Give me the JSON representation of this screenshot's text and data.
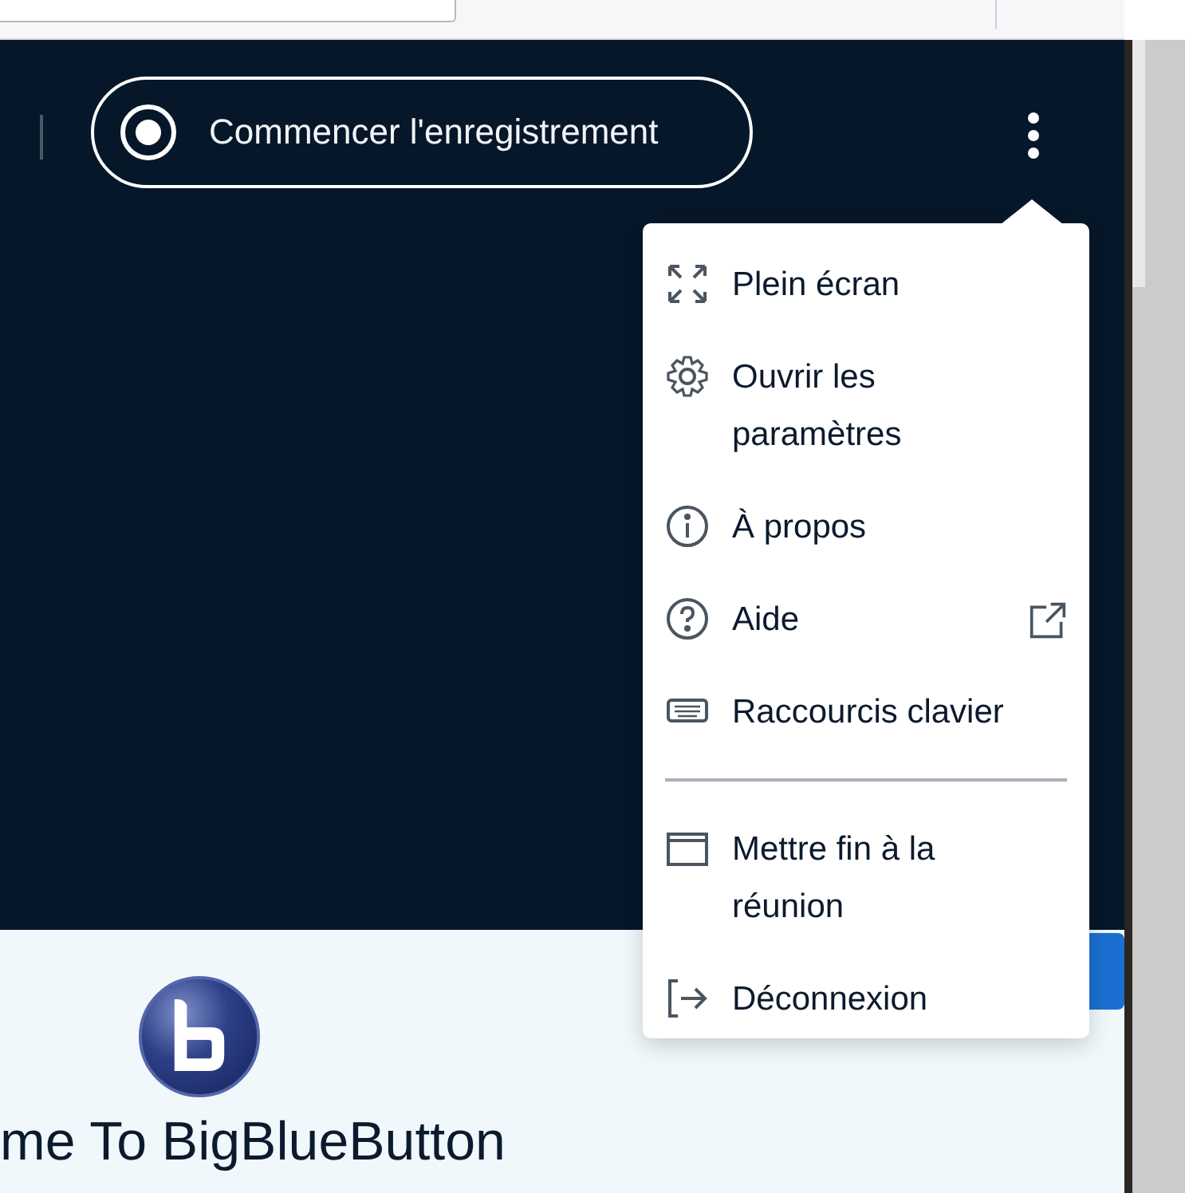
{
  "navbar": {
    "record_button": {
      "label": "Commencer l'enregistrement",
      "recording": false
    }
  },
  "options_menu": {
    "groups": [
      [
        {
          "kind": "fullscreen",
          "label": "Plein écran",
          "external": false
        },
        {
          "kind": "settings",
          "label": "Ouvrir les paramètres",
          "external": false
        },
        {
          "kind": "about",
          "label": "À propos",
          "external": false
        },
        {
          "kind": "help",
          "label": "Aide",
          "external": true
        },
        {
          "kind": "shortcuts",
          "label": "Raccourcis clavier",
          "external": false
        }
      ],
      [
        {
          "kind": "end_meeting",
          "label": "Mettre fin à la réunion",
          "external": false
        },
        {
          "kind": "logout",
          "label": "Déconnexion",
          "external": false
        }
      ]
    ]
  },
  "welcome": {
    "title": "me To BigBlueButton"
  }
}
